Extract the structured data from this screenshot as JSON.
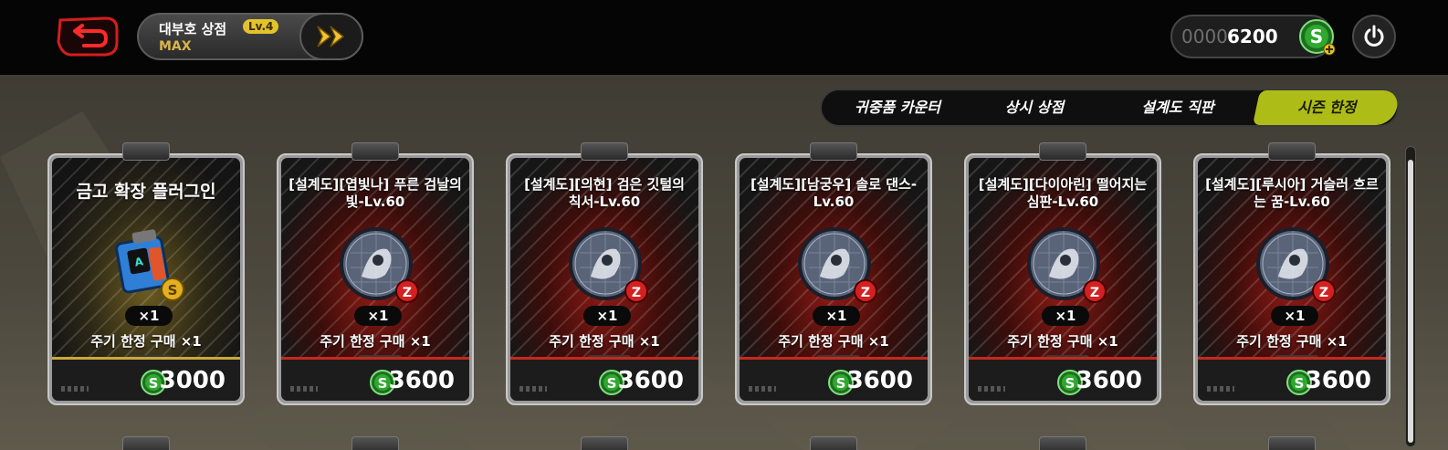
{
  "header": {
    "shop_name": "대부호 상점",
    "level": "Lv.4",
    "level_status": "MAX"
  },
  "currency": {
    "dim_digits": "0000",
    "value": "6200"
  },
  "tabs": [
    {
      "label": "귀중품 카운터",
      "active": false
    },
    {
      "label": "상시 상점",
      "active": false
    },
    {
      "label": "설계도 직판",
      "active": false
    },
    {
      "label": "시즌 한정",
      "active": true
    }
  ],
  "cards": [
    {
      "title": "금고 확장 플러그인",
      "qty": "×1",
      "limit": "주기 한정 구매 ×1",
      "price": "3000",
      "kind": "plugin"
    },
    {
      "title": "[설계도][엽빛나] 푸른 검날의 빛-Lv.60",
      "qty": "×1",
      "limit": "주기 한정 구매 ×1",
      "price": "3600",
      "kind": "blueprint"
    },
    {
      "title": "[설계도][의현] 검은 깃털의 칙서-Lv.60",
      "qty": "×1",
      "limit": "주기 한정 구매 ×1",
      "price": "3600",
      "kind": "blueprint"
    },
    {
      "title": "[설계도][남궁우] 솔로 댄스-Lv.60",
      "qty": "×1",
      "limit": "주기 한정 구매 ×1",
      "price": "3600",
      "kind": "blueprint"
    },
    {
      "title": "[설계도][다이아린] 떨어지는 심판-Lv.60",
      "qty": "×1",
      "limit": "주기 한정 구매 ×1",
      "price": "3600",
      "kind": "blueprint"
    },
    {
      "title": "[설계도][루시아] 거슬러 흐르는 꿈-Lv.60",
      "qty": "×1",
      "limit": "주기 한정 구매 ×1",
      "price": "3600",
      "kind": "blueprint"
    }
  ],
  "shop_tag": "SHOP",
  "colors": {
    "accent_tab": "#aebc17",
    "back_red": "#d41e1e",
    "coin_green": "#2ea82e",
    "price_border_red": "#c8281e",
    "price_border_gold": "#c9a93a"
  },
  "icons": [
    "back-arrow-icon",
    "fast-forward-icon",
    "s-coin-icon",
    "power-icon",
    "z-badge-icon",
    "s-badge-icon"
  ]
}
